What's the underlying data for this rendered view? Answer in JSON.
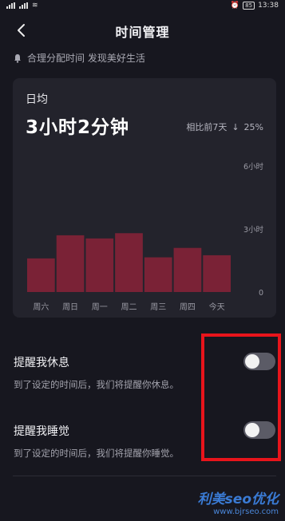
{
  "status_bar": {
    "time": "13:38",
    "battery": "85"
  },
  "header": {
    "title": "时间管理"
  },
  "subtitle": "合理分配时间 发现美好生活",
  "summary": {
    "label": "日均",
    "value": "3小时2分钟",
    "compare_label": "相比前7天",
    "compare_change": "25%"
  },
  "chart_data": {
    "type": "bar",
    "categories": [
      "周六",
      "周日",
      "周一",
      "周二",
      "周三",
      "周四",
      "今天"
    ],
    "values": [
      1.6,
      2.7,
      2.55,
      2.8,
      1.65,
      2.1,
      1.75
    ],
    "y_ticks": [
      "6小时",
      "3小时",
      "0"
    ],
    "ylim": [
      0,
      6
    ],
    "bar_color": "#7a2236",
    "grid": false
  },
  "settings": [
    {
      "title": "提醒我休息",
      "desc": "到了设定的时间后，我们将提醒你休息。",
      "enabled": false
    },
    {
      "title": "提醒我睡觉",
      "desc": "到了设定的时间后，我们将提醒你睡觉。",
      "enabled": false
    }
  ],
  "watermark": {
    "main": "利美seo优化",
    "url": "www.bjrseo.com"
  },
  "colors": {
    "background": "#17171f",
    "card": "#23232c",
    "highlight_box": "#e8141b"
  }
}
